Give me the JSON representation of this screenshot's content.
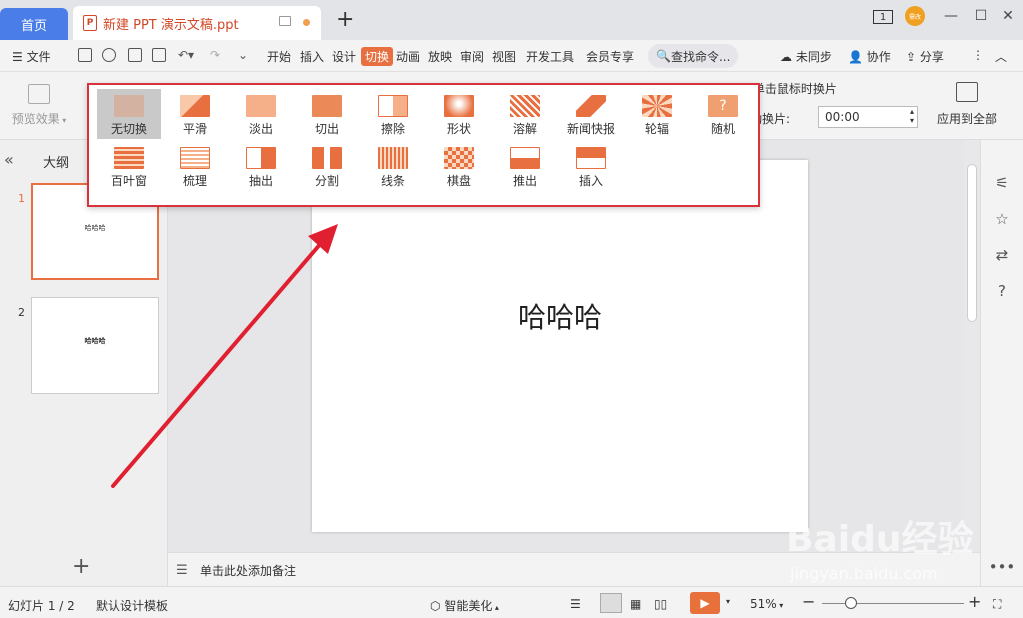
{
  "titlebar": {
    "home_tab": "首页",
    "doc_tab": "新建 PPT 演示文稿.ppt",
    "ppt_icon_letter": "P",
    "page_badge": "1",
    "avatar_text": "需改"
  },
  "menu": {
    "file": "文件",
    "tabs": [
      "开始",
      "插入",
      "设计",
      "切换",
      "动画",
      "放映",
      "审阅",
      "视图",
      "开发工具",
      "会员专享"
    ],
    "active_tab": "切换",
    "search_placeholder": "查找命令...",
    "sync": "未同步",
    "collab": "协作",
    "share": "分享"
  },
  "ribbon": {
    "preview": "预览效果",
    "click_switch": "单击鼠标时换片",
    "auto_switch": "自动换片:",
    "auto_time": "00:00",
    "apply_all": "应用到全部"
  },
  "transitions": [
    {
      "label": "无切换",
      "icon": "none-icon"
    },
    {
      "label": "平滑",
      "icon": "smooth-icon"
    },
    {
      "label": "淡出",
      "icon": "fade-icon"
    },
    {
      "label": "切出",
      "icon": "cut-icon"
    },
    {
      "label": "擦除",
      "icon": "wipe-icon"
    },
    {
      "label": "形状",
      "icon": "shape-icon"
    },
    {
      "label": "溶解",
      "icon": "dissolve-icon"
    },
    {
      "label": "新闻快报",
      "icon": "newsflash-icon"
    },
    {
      "label": "轮辐",
      "icon": "wheel-icon"
    },
    {
      "label": "随机",
      "icon": "random-icon"
    },
    {
      "label": "百叶窗",
      "icon": "blinds-icon"
    },
    {
      "label": "梳理",
      "icon": "comb-icon"
    },
    {
      "label": "抽出",
      "icon": "pull-icon"
    },
    {
      "label": "分割",
      "icon": "split-icon"
    },
    {
      "label": "线条",
      "icon": "lines-icon"
    },
    {
      "label": "棋盘",
      "icon": "checker-icon"
    },
    {
      "label": "推出",
      "icon": "push-icon"
    },
    {
      "label": "插入",
      "icon": "insert-icon"
    }
  ],
  "selected_transition": "无切换",
  "left_panel": {
    "outline": "大纲",
    "slides": [
      {
        "num": "1",
        "text": "哈哈哈"
      },
      {
        "num": "2",
        "text": "哈哈哈"
      }
    ]
  },
  "slide": {
    "title": "哈哈哈"
  },
  "notes_placeholder": "单击此处添加备注",
  "status": {
    "slide_counter": "幻灯片 1 / 2",
    "template": "默认设计模板",
    "beautify": "智能美化",
    "zoom": "51%"
  },
  "watermark": {
    "text": "Baidu经验",
    "url": "jingyan.baidu.com"
  },
  "colors": {
    "accent": "#e87040",
    "highlight_border": "#d8323c",
    "arrow": "#e02030"
  }
}
